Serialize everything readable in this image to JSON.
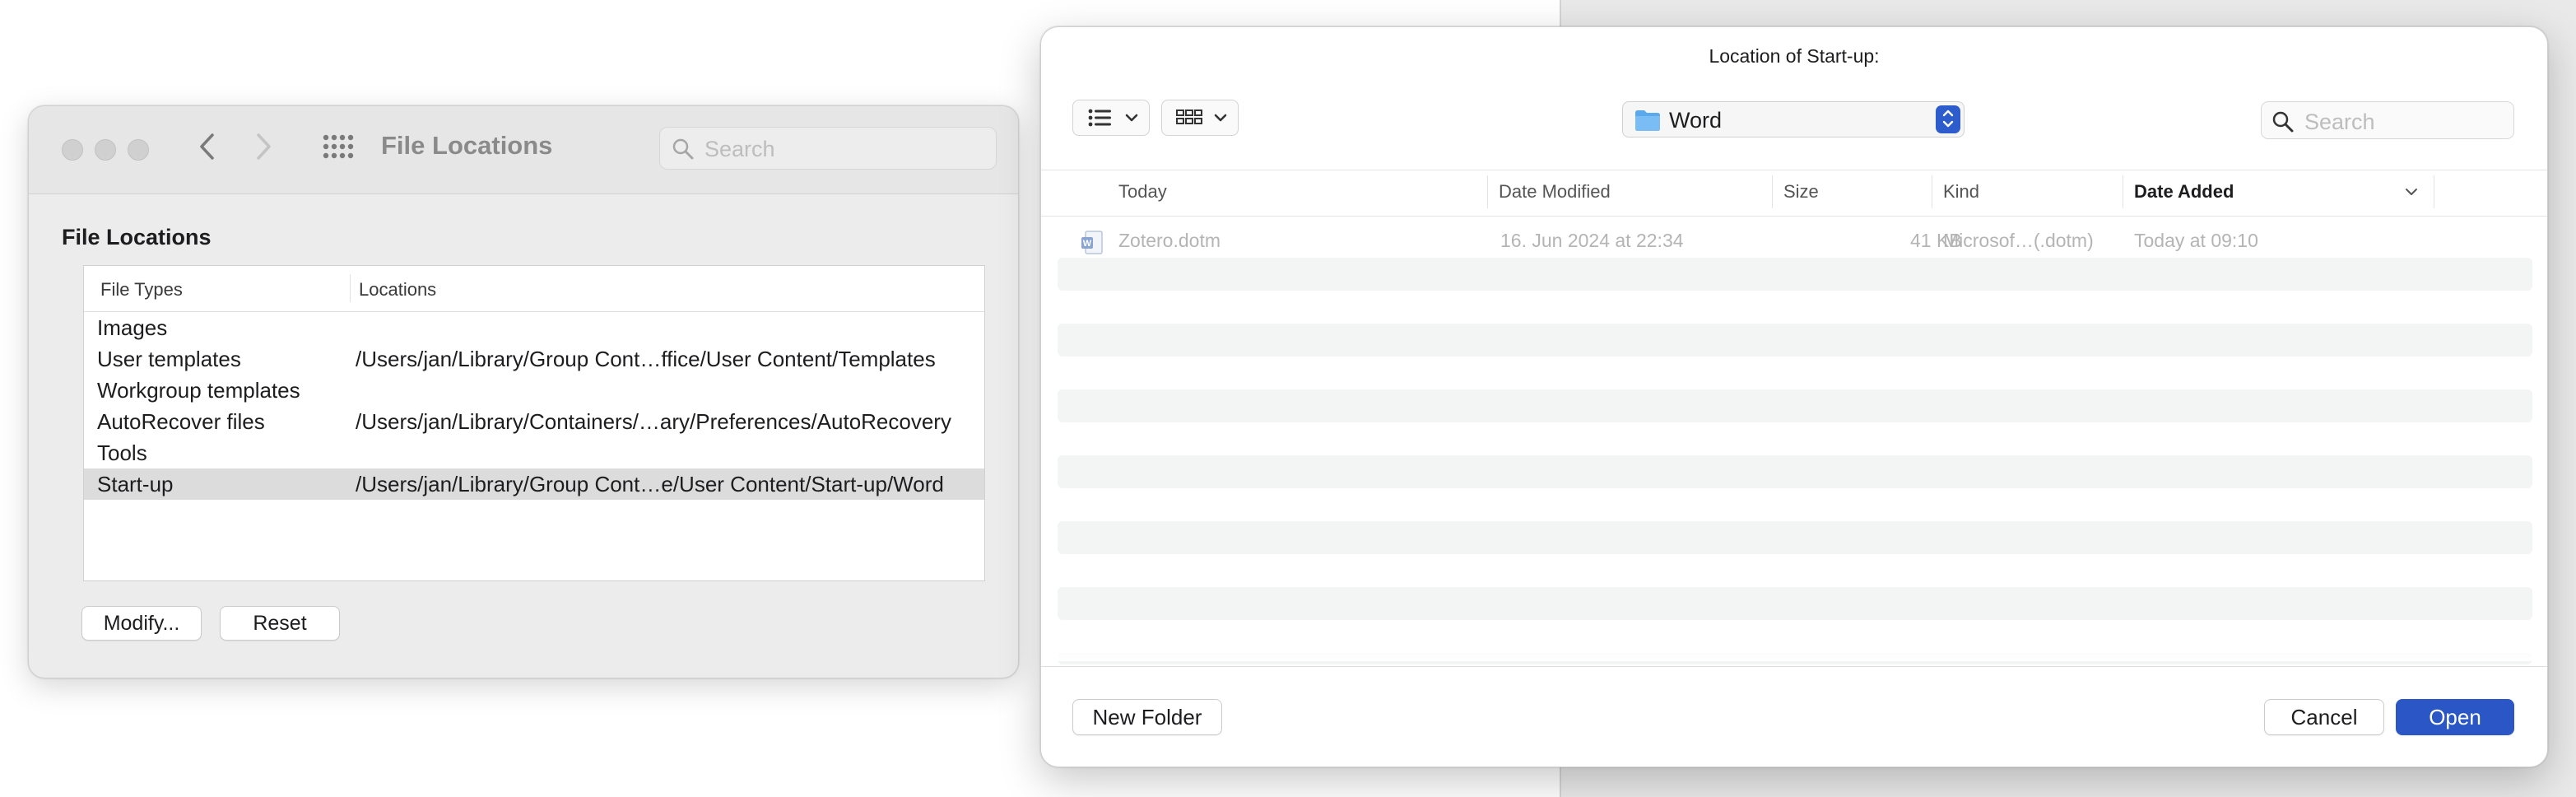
{
  "prefs_window": {
    "title": "File Locations",
    "search_placeholder": "Search",
    "section_title": "File Locations",
    "columns": [
      "File Types",
      "Locations"
    ],
    "rows": [
      {
        "type": "Images",
        "location": ""
      },
      {
        "type": "User templates",
        "location": "/Users/jan/Library/Group Cont…ffice/User Content/Templates"
      },
      {
        "type": "Workgroup templates",
        "location": ""
      },
      {
        "type": "AutoRecover files",
        "location": "/Users/jan/Library/Containers/…ary/Preferences/AutoRecovery"
      },
      {
        "type": "Tools",
        "location": ""
      },
      {
        "type": "Start-up",
        "location": "/Users/jan/Library/Group Cont…e/User Content/Start-up/Word",
        "selected": true
      }
    ],
    "modify_label": "Modify...",
    "reset_label": "Reset"
  },
  "open_dialog": {
    "title": "Location of Start-up:",
    "location_popup": "Word",
    "search_placeholder": "Search",
    "columns": {
      "name": "Today",
      "modified": "Date Modified",
      "size": "Size",
      "kind": "Kind",
      "added": "Date Added"
    },
    "files": [
      {
        "name": "Zotero.dotm",
        "modified": "16. Jun 2024 at 22:34",
        "size": "41 KB",
        "kind": "Microsof…(.dotm)",
        "added": "Today at 09:10"
      }
    ],
    "new_folder_label": "New Folder",
    "cancel_label": "Cancel",
    "open_label": "Open"
  },
  "colors": {
    "accent": "#2a56c6",
    "selected_row": "#dcdcdc",
    "stripe": "#f3f4f4"
  },
  "icons": [
    "back-arrow-icon",
    "forward-arrow-icon",
    "grid-icon",
    "search-icon",
    "list-view-icon",
    "column-view-icon",
    "folder-icon",
    "word-document-icon",
    "sort-chevron-icon"
  ]
}
